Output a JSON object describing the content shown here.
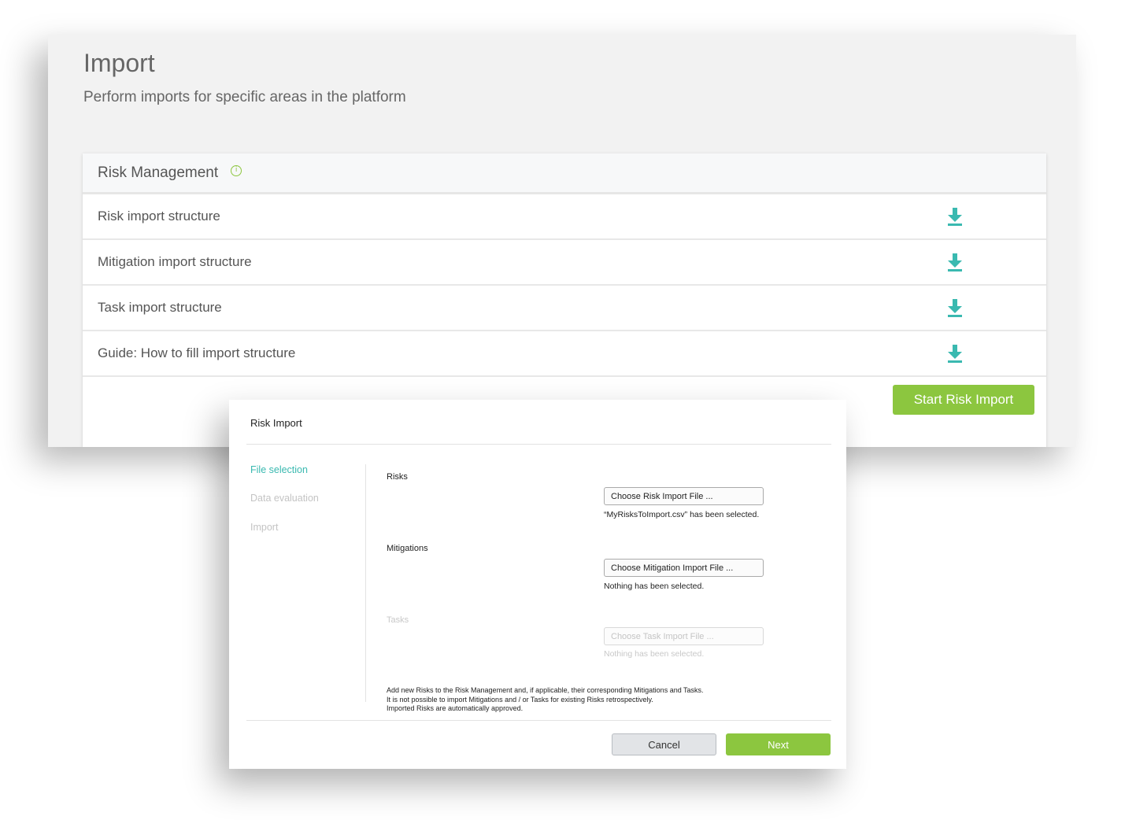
{
  "page": {
    "title": "Import",
    "subtitle": "Perform imports for specific areas in the platform"
  },
  "section": {
    "title": "Risk Management",
    "info_icon": "info-icon",
    "rows": [
      {
        "label": "Risk import structure",
        "icon": "download-icon"
      },
      {
        "label": "Mitigation import structure",
        "icon": "download-icon"
      },
      {
        "label": "Task import structure",
        "icon": "download-icon"
      },
      {
        "label": "Guide: How to fill import structure",
        "icon": "download-icon"
      }
    ],
    "start_button": "Start Risk Import"
  },
  "modal": {
    "title": "Risk Import",
    "steps": [
      {
        "label": "File selection",
        "active": true
      },
      {
        "label": "Data evaluation",
        "active": false
      },
      {
        "label": "Import",
        "active": false
      }
    ],
    "fields": [
      {
        "label": "Risks",
        "button": "Choose Risk Import File ...",
        "status": "“MyRisksToImport.csv” has been selected.",
        "enabled": true
      },
      {
        "label": "Mitigations",
        "button": "Choose Mitigation Import File ...",
        "status": "Nothing has been selected.",
        "enabled": true
      },
      {
        "label": "Tasks",
        "button": "Choose Task Import File ...",
        "status": "Nothing has been selected.",
        "enabled": false
      }
    ],
    "notes": [
      "Add new Risks to the Risk Management and, if applicable, their corresponding Mitigations and Tasks.",
      "It is not possible to import Mitigations and / or Tasks for existing Risks retrospectively.",
      "Imported Risks are automatically approved."
    ],
    "cancel_button": "Cancel",
    "next_button": "Next"
  },
  "colors": {
    "accent_green": "#8cc63f",
    "accent_teal": "#3ab9b0",
    "background": "#f2f2f2"
  }
}
